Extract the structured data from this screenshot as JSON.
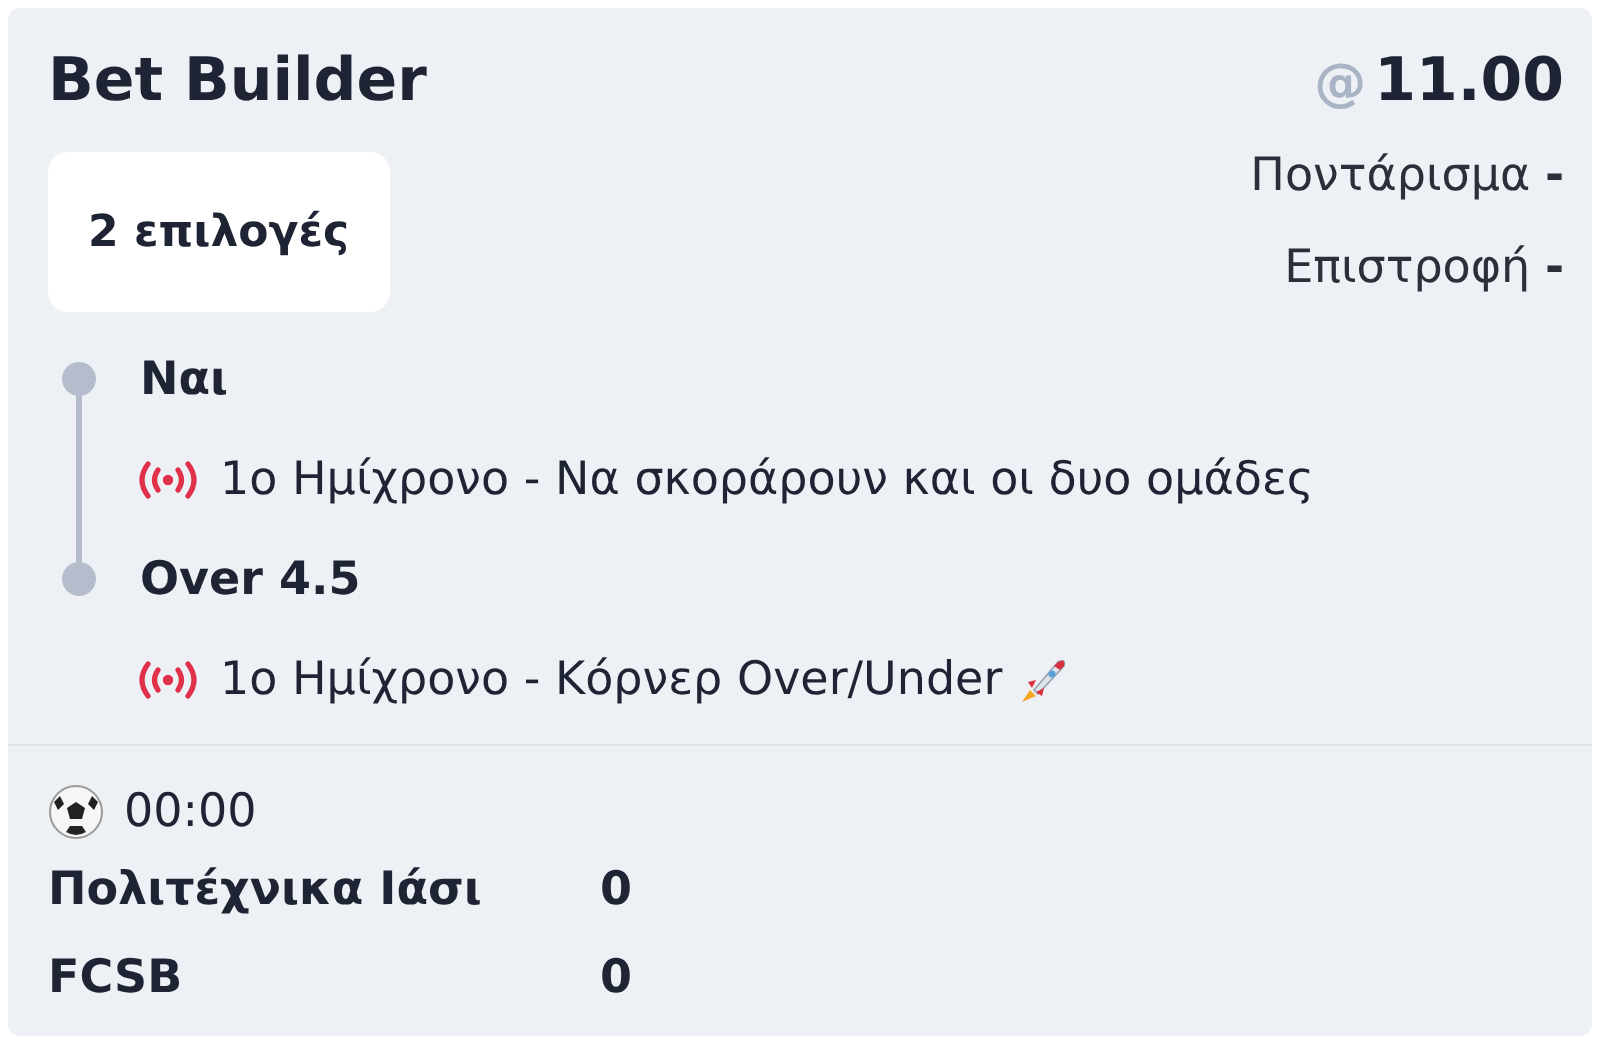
{
  "title": "Bet Builder",
  "selections_count": "2 επιλογές",
  "odds": {
    "symbol": "@",
    "value": "11.00"
  },
  "summary": [
    "Ποντάρισμα **-**",
    "Επιστροφή **-**"
  ],
  "selections": [
    {
      "name": "Ναι",
      "market": "1ο Ημίχρονο - Να σκοράρουν και οι δυο ομάδες",
      "live": true,
      "boosted": false
    },
    {
      "name": "Over 4.5",
      "market": "1ο Ημίχρονο - Κόρνερ Over/Under",
      "live": true,
      "boosted": true
    }
  ],
  "match": {
    "time": "00:00",
    "teams": [
      {
        "name": "Πολιτέχνικα Ιάσι",
        "score": "0"
      },
      {
        "name": "FCSB",
        "score": "0"
      }
    ]
  }
}
